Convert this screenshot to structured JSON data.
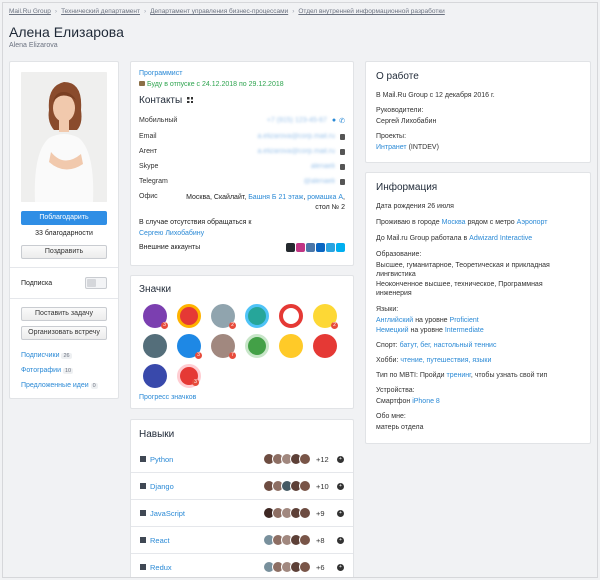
{
  "breadcrumbs": [
    "Mail.Ru Group",
    "Технический департамент",
    "Департамент управления бизнес-процессами",
    "Отдел внутренней информационной разработки"
  ],
  "profile": {
    "name": "Алена Елизарова",
    "latin_name": "Alena Elizarova",
    "thank_button": "Поблагодарить",
    "thanks_count": "33 благодарности",
    "congrats_button": "Поздравить",
    "subscription_label": "Подписка",
    "task_button": "Поставить задачу",
    "meeting_button": "Организовать встречу",
    "links": [
      {
        "label": "Подписчики",
        "count": "26"
      },
      {
        "label": "Фотографии",
        "count": "10"
      },
      {
        "label": "Предложенные идеи",
        "count": "0"
      }
    ]
  },
  "contacts": {
    "role": "Программист",
    "vacation": "Буду в отпуске с 24.12.2018 по 29.12.2018",
    "title": "Контакты",
    "mobile_label": "Мобильный",
    "mobile_value": "+7 (915) 123-45-67",
    "email_label": "Email",
    "email_value": "a.elizarova@corp.mail.ru",
    "agent_label": "Агент",
    "agent_value": "a.elizarova@corp.mail.ru",
    "skype_label": "Skype",
    "skype_value": "alenaeli",
    "telegram_label": "Telegram",
    "telegram_value": "@alenaeli",
    "office_label": "Офис",
    "office_prefix": "Москва, Скайлайт,",
    "office_tower": "Башня Б 21 этаж",
    "office_room": "ромашка А",
    "office_desk": "стол № 2",
    "absence_text": "В случае отсутствия обращаться к",
    "absence_person": "Сергею Лихобабину",
    "accounts_label": "Внешние аккаунты"
  },
  "badges": {
    "title": "Значки",
    "progress_link": "Прогресс значков"
  },
  "skills": {
    "title": "Навыки",
    "items": [
      {
        "name": "Python",
        "plus": "+12"
      },
      {
        "name": "Django",
        "plus": "+10"
      },
      {
        "name": "JavaScript",
        "plus": "+9"
      },
      {
        "name": "React",
        "plus": "+8"
      },
      {
        "name": "Redux",
        "plus": "+6"
      }
    ]
  },
  "about": {
    "title": "О работе",
    "since": "В Mail.Ru Group с 12 декабря 2016 г.",
    "managers_label": "Руководители:",
    "manager": "Сергей Лихобабин",
    "projects_label": "Проекты:",
    "project_link": "Интранет",
    "project_rest": "(INTDEV)"
  },
  "info": {
    "title": "Информация",
    "birthday": "Дата рождения 26 июля",
    "lives_prefix": "Проживаю в городе",
    "city": "Москва",
    "lives_mid": "рядом с метро",
    "metro": "Аэропорт",
    "before_prefix": "До Mail.ru Group работала в",
    "before_company": "Adwizard Interactive",
    "education_label": "Образование:",
    "education_1": "Высшее, гуманитарное, Теоретическая и прикладная",
    "education_1b": "лингвистика",
    "education_2": "Неоконченное высшее, техническое, Программная",
    "education_2b": "инженерия",
    "languages_label": "Языки:",
    "lang1": "Английский",
    "lang1_mid": "на уровне",
    "lang1_level": "Proficient",
    "lang2": "Немецкий",
    "lang2_mid": "на уровне",
    "lang2_level": "Intermediate",
    "sport_label": "Спорт:",
    "sport_values": "батут, бег, настольный теннис",
    "hobby_label": "Хобби:",
    "hobby_values": "чтение, путешествия, языки",
    "mbti_prefix": "Тип по MBTI: Пройди",
    "mbti_link": "тренинг",
    "mbti_suffix": ", чтобы узнать свой тип",
    "devices_label": "Устройства:",
    "device_prefix": "Смартфон",
    "device": "iPhone 8",
    "about_me_label": "Обо мне:",
    "about_me": "матерь отдела"
  },
  "colors": {
    "accent": "#2b8ad6",
    "primary_button": "#2f8ee5",
    "vacation": "#2ea44f"
  }
}
